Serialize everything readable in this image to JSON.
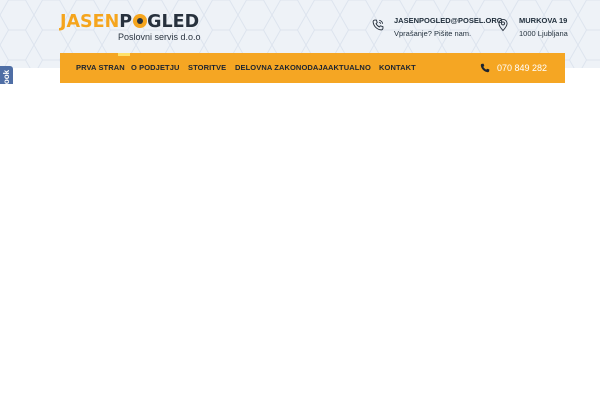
{
  "brand": {
    "logo_part1": "JASEN",
    "logo_part2": "GLED",
    "logo_mid": "P",
    "subtitle": "Poslovni servis d.o.o",
    "colors": {
      "accent": "#f5a623",
      "dark": "#27313d"
    }
  },
  "contact": {
    "email": "JASENPOGLED@POSEL.ORG",
    "email_note": "Vprašanje? Pišite nam.",
    "email_icon": "phone-icon",
    "address_line1": "MURKOVA 19",
    "address_line2": "1000 Ljubljana",
    "address_icon": "map-pin-icon"
  },
  "nav": {
    "items": [
      "PRVA STRAN",
      "O PODJETJU",
      "STORITVE",
      "DELOVNA ZAKONODAJA",
      "AKTUALNO",
      "KONTAKT"
    ],
    "phone": "070 849 282",
    "phone_icon": "phone-icon"
  },
  "social": {
    "facebook_label": "facebook"
  }
}
